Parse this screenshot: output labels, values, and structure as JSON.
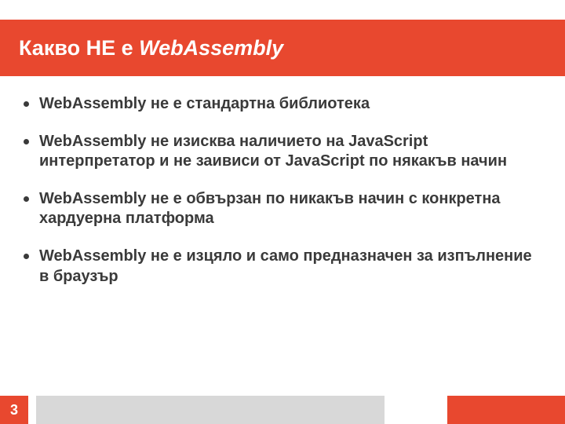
{
  "header": {
    "title_prefix": "Какво НЕ е ",
    "title_italic": "WebAssembly"
  },
  "bullets": [
    "WebAssembly не е стандартна библиотека",
    "WebAssembly не изисква наличието на JavaScript интерпретатор и не заивиси от JavaScript по някакъв начин",
    "WebAssembly не е обвързан по никакъв начин с конкретна хардуерна платформа",
    "WebAssembly не е изцяло и само предназначен за изпълнение в браузър"
  ],
  "page_number": "3"
}
